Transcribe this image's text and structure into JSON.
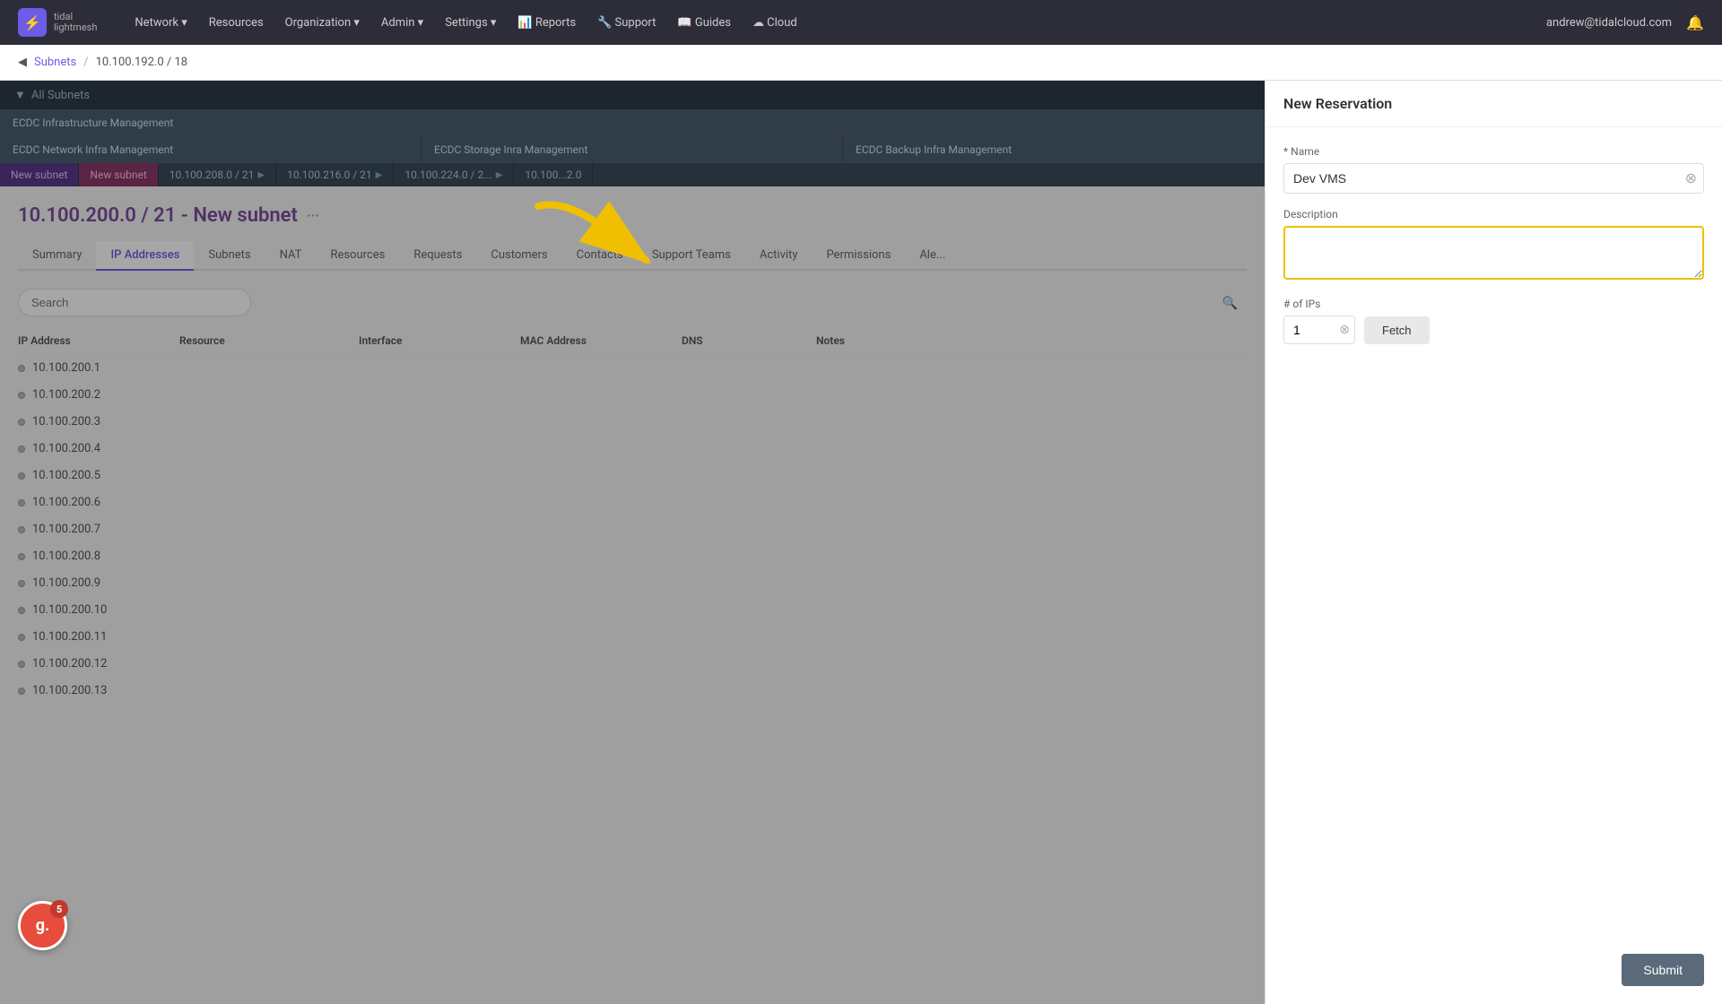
{
  "app": {
    "logo_line1": "tidal",
    "logo_line2": "lightmesh"
  },
  "nav": {
    "items": [
      {
        "label": "Network",
        "has_arrow": true
      },
      {
        "label": "Resources",
        "has_arrow": false
      },
      {
        "label": "Organization",
        "has_arrow": true
      },
      {
        "label": "Admin",
        "has_arrow": true
      },
      {
        "label": "Settings",
        "has_arrow": true
      },
      {
        "label": "Reports",
        "has_arrow": false
      },
      {
        "label": "Support",
        "has_arrow": false
      },
      {
        "label": "Guides",
        "has_arrow": false
      },
      {
        "label": "Cloud",
        "has_arrow": false
      }
    ],
    "user": "andrew@tidalcloud.com"
  },
  "breadcrumb": {
    "parent": "Subnets",
    "current": "10.100.192.0 / 18"
  },
  "tree": {
    "all_label": "All Subnets",
    "row1": [
      "ECDC Infrastructure Management"
    ],
    "row2_items": [
      "ECDC Network Infra Management",
      "ECDC Storage Inra Management",
      "ECDC Backup Infra Management"
    ],
    "sub_items": [
      "New subnet",
      "New subnet",
      "10.100.208.0 / 21",
      "10.100.216.0 / 21",
      "10.100.224.0 / 2...",
      "10.100...2.0"
    ]
  },
  "subnet": {
    "title": "10.100.200.0 / 21 - New subnet"
  },
  "tabs": {
    "items": [
      "Summary",
      "IP Addresses",
      "Subnets",
      "NAT",
      "Resources",
      "Requests",
      "Customers",
      "Contacts",
      "Support Teams",
      "Activity",
      "Permissions",
      "Ale..."
    ]
  },
  "search": {
    "placeholder": "Search"
  },
  "table": {
    "headers": [
      "IP Address",
      "Resource",
      "Interface",
      "MAC Address",
      "DNS",
      "Notes"
    ],
    "rows": [
      {
        "ip": "10.100.200.1"
      },
      {
        "ip": "10.100.200.2"
      },
      {
        "ip": "10.100.200.3"
      },
      {
        "ip": "10.100.200.4"
      },
      {
        "ip": "10.100.200.5"
      },
      {
        "ip": "10.100.200.6"
      },
      {
        "ip": "10.100.200.7"
      },
      {
        "ip": "10.100.200.8"
      },
      {
        "ip": "10.100.200.9"
      },
      {
        "ip": "10.100.200.10"
      },
      {
        "ip": "10.100.200.11"
      },
      {
        "ip": "10.100.200.12"
      },
      {
        "ip": "10.100.200.13"
      }
    ]
  },
  "reservation": {
    "panel_title": "New Reservation",
    "name_label": "* Name",
    "name_value": "Dev VMS",
    "description_label": "Description",
    "ip_count_label": "# of IPs",
    "ip_count_value": "1",
    "fetch_label": "Fetch",
    "submit_label": "Submit"
  },
  "g2": {
    "letter": "g.",
    "badge_num": "5"
  }
}
